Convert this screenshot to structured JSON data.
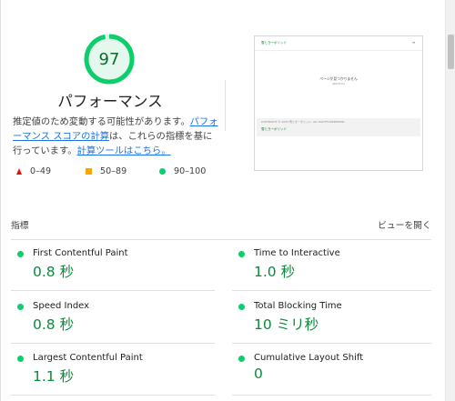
{
  "performance": {
    "score": "97",
    "title": "パフォーマンス",
    "gauge_color": "#0cce6b",
    "description": {
      "text1": "推定値のため変動する可能性があります。",
      "link1": "パフォーマンス スコアの計算",
      "text2": "は、これらの指標を基に行っています。",
      "link2": "計算ツールはこちら。"
    },
    "legend": [
      {
        "label": "0–49",
        "shape": "triangle",
        "color": "#eb0f00"
      },
      {
        "label": "50–89",
        "shape": "square",
        "color": "#ffa400"
      },
      {
        "label": "90–100",
        "shape": "circle",
        "color": "#0cce6b"
      }
    ]
  },
  "screenshot": {
    "header_link": "雪ときーボリッド",
    "menu_icon": "hamburger-icon",
    "message": "ページが見つかりません",
    "sub_message": "404 Error",
    "footer_text": "COPYRIGHT © 2023 雪ときーボリッド. ALL RIGHTS RESERVED.",
    "footer_link": "雪ときーボリッド"
  },
  "metrics": {
    "label": "指標",
    "toggle": "ビューを開く",
    "items": [
      {
        "label": "First Contentful Paint",
        "value": "0.8 秒",
        "status_color": "#0cce6b"
      },
      {
        "label": "Time to Interactive",
        "value": "1.0 秒",
        "status_color": "#0cce6b"
      },
      {
        "label": "Speed Index",
        "value": "0.8 秒",
        "status_color": "#0cce6b"
      },
      {
        "label": "Total Blocking Time",
        "value": "10 ミリ秒",
        "status_color": "#0cce6b"
      },
      {
        "label": "Largest Contentful Paint",
        "value": "1.1 秒",
        "status_color": "#0cce6b"
      },
      {
        "label": "Cumulative Layout Shift",
        "value": "0",
        "status_color": "#0cce6b"
      }
    ]
  }
}
